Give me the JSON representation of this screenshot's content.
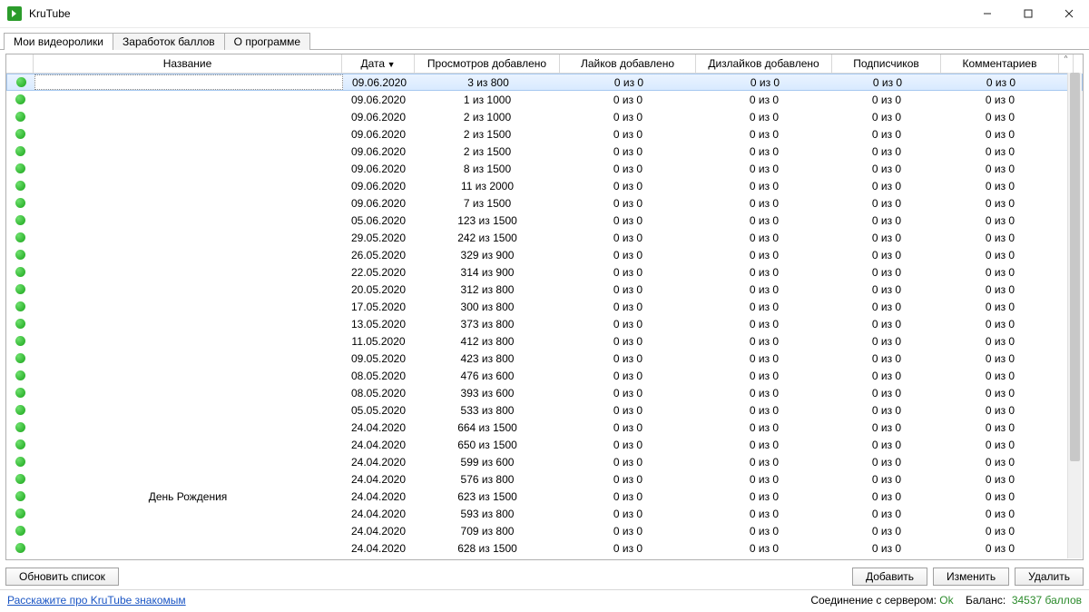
{
  "window": {
    "title": "KruTube"
  },
  "tabs": [
    {
      "label": "Мои видеоролики",
      "active": true
    },
    {
      "label": "Заработок баллов",
      "active": false
    },
    {
      "label": "О программе",
      "active": false
    }
  ],
  "columns": {
    "status": "",
    "name": "Название",
    "date": "Дата",
    "views": "Просмотров добавлено",
    "likes": "Лайков добавлено",
    "dislikes": "Дизлайков добавлено",
    "subs": "Подписчиков",
    "comments": "Комментариев"
  },
  "sort": {
    "column": "date",
    "dir": "desc"
  },
  "rows": [
    {
      "name": "",
      "date": "09.06.2020",
      "views": "3 из 800",
      "likes": "0 из 0",
      "dislikes": "0 из 0",
      "subs": "0 из 0",
      "comments": "0 из 0",
      "selected": true
    },
    {
      "name": "",
      "date": "09.06.2020",
      "views": "1 из 1000",
      "likes": "0 из 0",
      "dislikes": "0 из 0",
      "subs": "0 из 0",
      "comments": "0 из 0"
    },
    {
      "name": "",
      "date": "09.06.2020",
      "views": "2 из 1000",
      "likes": "0 из 0",
      "dislikes": "0 из 0",
      "subs": "0 из 0",
      "comments": "0 из 0"
    },
    {
      "name": "",
      "date": "09.06.2020",
      "views": "2 из 1500",
      "likes": "0 из 0",
      "dislikes": "0 из 0",
      "subs": "0 из 0",
      "comments": "0 из 0"
    },
    {
      "name": "",
      "date": "09.06.2020",
      "views": "2 из 1500",
      "likes": "0 из 0",
      "dislikes": "0 из 0",
      "subs": "0 из 0",
      "comments": "0 из 0"
    },
    {
      "name": "",
      "date": "09.06.2020",
      "views": "8 из 1500",
      "likes": "0 из 0",
      "dislikes": "0 из 0",
      "subs": "0 из 0",
      "comments": "0 из 0"
    },
    {
      "name": "",
      "date": "09.06.2020",
      "views": "11 из 2000",
      "likes": "0 из 0",
      "dislikes": "0 из 0",
      "subs": "0 из 0",
      "comments": "0 из 0"
    },
    {
      "name": "",
      "date": "09.06.2020",
      "views": "7 из 1500",
      "likes": "0 из 0",
      "dislikes": "0 из 0",
      "subs": "0 из 0",
      "comments": "0 из 0"
    },
    {
      "name": "",
      "date": "05.06.2020",
      "views": "123 из 1500",
      "likes": "0 из 0",
      "dislikes": "0 из 0",
      "subs": "0 из 0",
      "comments": "0 из 0"
    },
    {
      "name": "",
      "date": "29.05.2020",
      "views": "242 из 1500",
      "likes": "0 из 0",
      "dislikes": "0 из 0",
      "subs": "0 из 0",
      "comments": "0 из 0"
    },
    {
      "name": "",
      "date": "26.05.2020",
      "views": "329 из 900",
      "likes": "0 из 0",
      "dislikes": "0 из 0",
      "subs": "0 из 0",
      "comments": "0 из 0"
    },
    {
      "name": "",
      "date": "22.05.2020",
      "views": "314 из 900",
      "likes": "0 из 0",
      "dislikes": "0 из 0",
      "subs": "0 из 0",
      "comments": "0 из 0"
    },
    {
      "name": "",
      "date": "20.05.2020",
      "views": "312 из 800",
      "likes": "0 из 0",
      "dislikes": "0 из 0",
      "subs": "0 из 0",
      "comments": "0 из 0"
    },
    {
      "name": "",
      "date": "17.05.2020",
      "views": "300 из 800",
      "likes": "0 из 0",
      "dislikes": "0 из 0",
      "subs": "0 из 0",
      "comments": "0 из 0"
    },
    {
      "name": "",
      "date": "13.05.2020",
      "views": "373 из 800",
      "likes": "0 из 0",
      "dislikes": "0 из 0",
      "subs": "0 из 0",
      "comments": "0 из 0"
    },
    {
      "name": "",
      "date": "11.05.2020",
      "views": "412 из 800",
      "likes": "0 из 0",
      "dislikes": "0 из 0",
      "subs": "0 из 0",
      "comments": "0 из 0"
    },
    {
      "name": "",
      "date": "09.05.2020",
      "views": "423 из 800",
      "likes": "0 из 0",
      "dislikes": "0 из 0",
      "subs": "0 из 0",
      "comments": "0 из 0"
    },
    {
      "name": "",
      "date": "08.05.2020",
      "views": "476 из 600",
      "likes": "0 из 0",
      "dislikes": "0 из 0",
      "subs": "0 из 0",
      "comments": "0 из 0"
    },
    {
      "name": "",
      "date": "08.05.2020",
      "views": "393 из 600",
      "likes": "0 из 0",
      "dislikes": "0 из 0",
      "subs": "0 из 0",
      "comments": "0 из 0"
    },
    {
      "name": "",
      "date": "05.05.2020",
      "views": "533 из 800",
      "likes": "0 из 0",
      "dislikes": "0 из 0",
      "subs": "0 из 0",
      "comments": "0 из 0"
    },
    {
      "name": "",
      "date": "24.04.2020",
      "views": "664 из 1500",
      "likes": "0 из 0",
      "dislikes": "0 из 0",
      "subs": "0 из 0",
      "comments": "0 из 0"
    },
    {
      "name": "",
      "date": "24.04.2020",
      "views": "650 из 1500",
      "likes": "0 из 0",
      "dislikes": "0 из 0",
      "subs": "0 из 0",
      "comments": "0 из 0"
    },
    {
      "name": "",
      "date": "24.04.2020",
      "views": "599 из 600",
      "likes": "0 из 0",
      "dislikes": "0 из 0",
      "subs": "0 из 0",
      "comments": "0 из 0"
    },
    {
      "name": "",
      "date": "24.04.2020",
      "views": "576 из 800",
      "likes": "0 из 0",
      "dislikes": "0 из 0",
      "subs": "0 из 0",
      "comments": "0 из 0"
    },
    {
      "name": "День Рождения",
      "date": "24.04.2020",
      "views": "623 из 1500",
      "likes": "0 из 0",
      "dislikes": "0 из 0",
      "subs": "0 из 0",
      "comments": "0 из 0"
    },
    {
      "name": "",
      "date": "24.04.2020",
      "views": "593 из 800",
      "likes": "0 из 0",
      "dislikes": "0 из 0",
      "subs": "0 из 0",
      "comments": "0 из 0"
    },
    {
      "name": "",
      "date": "24.04.2020",
      "views": "709 из 800",
      "likes": "0 из 0",
      "dislikes": "0 из 0",
      "subs": "0 из 0",
      "comments": "0 из 0"
    },
    {
      "name": "",
      "date": "24.04.2020",
      "views": "628 из 1500",
      "likes": "0 из 0",
      "dislikes": "0 из 0",
      "subs": "0 из 0",
      "comments": "0 из 0"
    }
  ],
  "buttons": {
    "refresh": "Обновить список",
    "add": "Добавить",
    "edit": "Изменить",
    "delete": "Удалить"
  },
  "status": {
    "promo_link": "Расскажите про KruTube знакомым",
    "conn_label": "Соединение с сервером:",
    "conn_value": "Ok",
    "balance_label": "Баланс:",
    "balance_value": "34537 баллов"
  }
}
